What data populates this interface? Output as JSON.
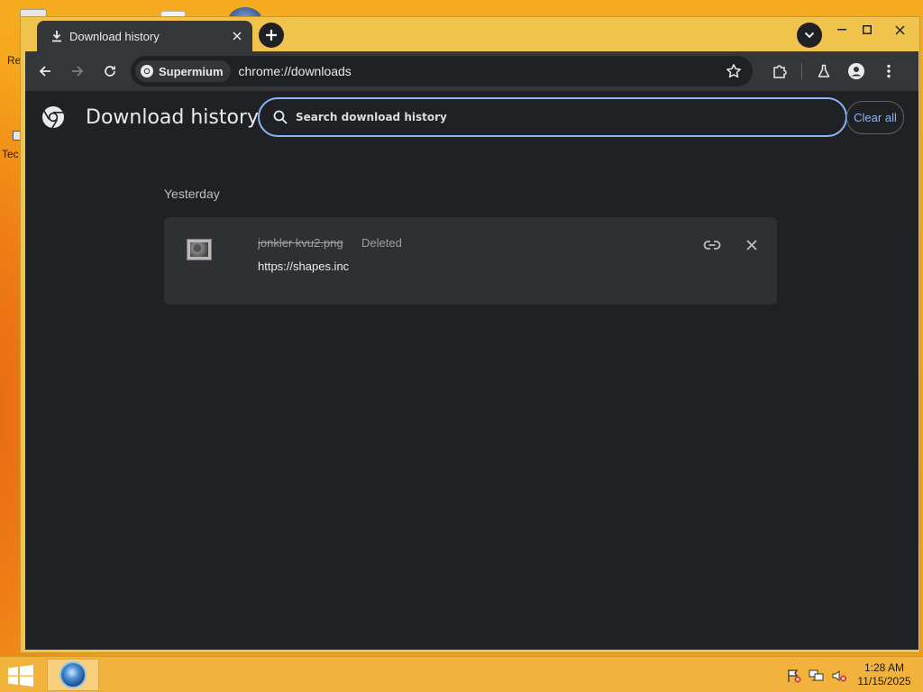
{
  "desktop": {
    "labels": [
      "Re",
      "Tec"
    ]
  },
  "browser": {
    "tab": {
      "title": "Download history",
      "icon": "download-icon"
    },
    "toolbar": {
      "site_chip": "Supermium",
      "url": "chrome://downloads"
    }
  },
  "page": {
    "title": "Download history",
    "search": {
      "placeholder": "Search download history",
      "value": ""
    },
    "clear_all": "Clear all",
    "sections": [
      {
        "date": "Yesterday",
        "items": [
          {
            "file_name": "jonkler kvu2.png",
            "status": "Deleted",
            "url": "https://shapes.inc"
          }
        ]
      }
    ]
  },
  "taskbar": {
    "time": "1:28 AM",
    "date": "11/15/2025"
  },
  "colors": {
    "accent": "#8ab4f8",
    "page_bg": "#202124",
    "toolbar_bg": "#35363a",
    "card_bg": "#2f3033",
    "window_frame": "#f0c44c",
    "desktop": "#f39b18"
  }
}
